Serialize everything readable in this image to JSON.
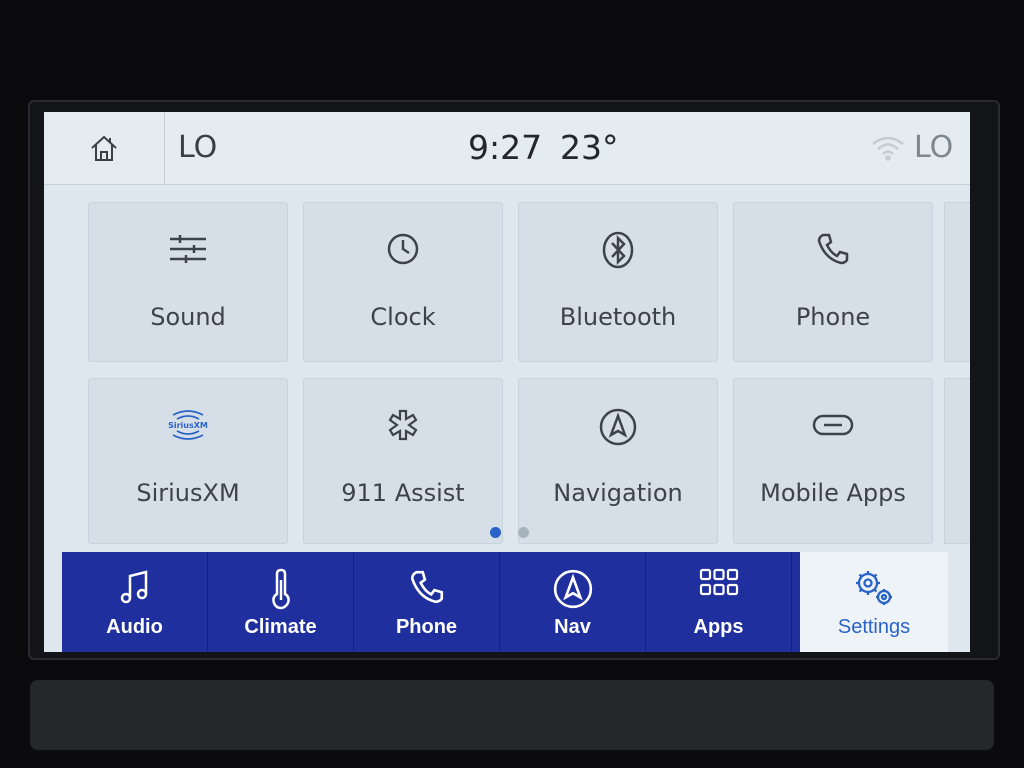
{
  "status_bar": {
    "left_label": "LO",
    "time": "9:27",
    "temperature": "23°",
    "right_label": "LO"
  },
  "tiles": [
    {
      "label": "Sound",
      "icon": "sliders-icon"
    },
    {
      "label": "Clock",
      "icon": "clock-icon"
    },
    {
      "label": "Bluetooth",
      "icon": "bluetooth-icon"
    },
    {
      "label": "Phone",
      "icon": "phone-icon"
    },
    {
      "label": "SiriusXM",
      "icon": "siriusxm-icon",
      "logo_text": "SiriusXM"
    },
    {
      "label": "911 Assist",
      "icon": "asterisk-icon"
    },
    {
      "label": "Navigation",
      "icon": "compass-icon"
    },
    {
      "label": "Mobile Apps",
      "icon": "link-icon"
    }
  ],
  "pager": {
    "current_page": 1,
    "total_pages": 2
  },
  "nav": [
    {
      "label": "Audio",
      "icon": "music-note-icon"
    },
    {
      "label": "Climate",
      "icon": "thermometer-icon"
    },
    {
      "label": "Phone",
      "icon": "phone-icon"
    },
    {
      "label": "Nav",
      "icon": "compass-icon"
    },
    {
      "label": "Apps",
      "icon": "apps-grid-icon"
    },
    {
      "label": "Settings",
      "icon": "gears-icon",
      "active": true
    }
  ],
  "colors": {
    "nav_background": "#1f2f9e",
    "active_tab_text": "#2a63c8",
    "pager_active": "#2a63c8",
    "pager_inactive": "#a8b3be"
  }
}
